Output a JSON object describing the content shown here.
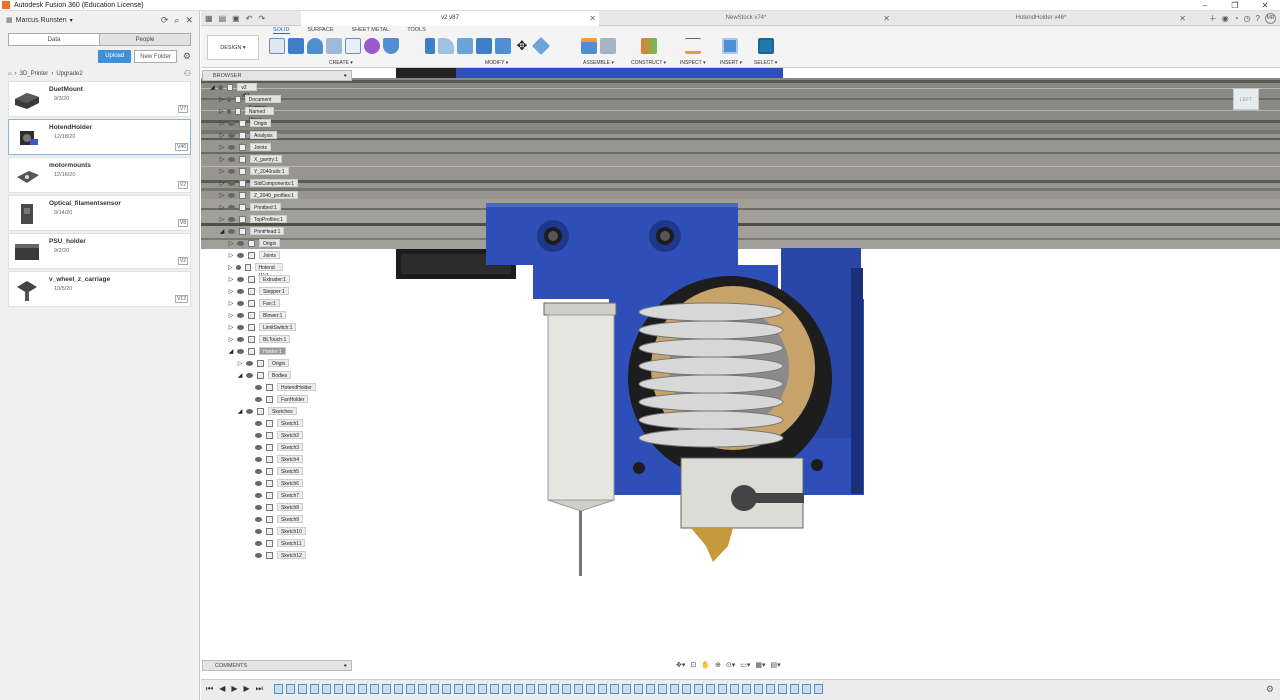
{
  "app": {
    "title": "Autodesk Fusion 360 (Education License)"
  },
  "datapanel": {
    "user": "Marcus Runsten",
    "tabs": [
      "Data",
      "People"
    ],
    "upload": "Upload",
    "new_folder": "New Folder",
    "breadcrumb": [
      "3D_Printer",
      "Upgrade2"
    ],
    "files": [
      {
        "name": "DuetMount",
        "date": "9/3/20",
        "version": "V7"
      },
      {
        "name": "HotendHolder",
        "date": "12/18/20",
        "version": "V46"
      },
      {
        "name": "motormounts",
        "date": "12/16/20",
        "version": "V2"
      },
      {
        "name": "Optical_filamentsensor",
        "date": "9/14/20",
        "version": "V8"
      },
      {
        "name": "PSU_holder",
        "date": "9/2/20",
        "version": "V2"
      },
      {
        "name": "v_wheel_z_carriage",
        "date": "10/5/20",
        "version": "V12"
      }
    ]
  },
  "doctabs": [
    "v2 v87",
    "NewStock v74*",
    "HotendHolder v46*"
  ],
  "user_initials": "MR",
  "toolbar": {
    "design": "DESIGN",
    "workspace_tabs": [
      "SOLID",
      "SURFACE",
      "SHEET METAL",
      "TOOLS"
    ],
    "groups": [
      "CREATE",
      "MODIFY",
      "ASSEMBLE",
      "CONSTRUCT",
      "INSPECT",
      "INSERT",
      "SELECT"
    ]
  },
  "browser": {
    "title": "BROWSER",
    "rows": [
      {
        "label": "v2 v87",
        "depth": 0,
        "arrow": "◢",
        "highlight": false
      },
      {
        "label": "Document Settings",
        "depth": 1,
        "arrow": "▷",
        "highlight": false
      },
      {
        "label": "Named Views",
        "depth": 1,
        "arrow": "▷",
        "highlight": false
      },
      {
        "label": "Origin",
        "depth": 1,
        "arrow": "▷",
        "highlight": false
      },
      {
        "label": "Analysis",
        "depth": 1,
        "arrow": "▷",
        "highlight": false
      },
      {
        "label": "Joints",
        "depth": 1,
        "arrow": "▷",
        "highlight": false
      },
      {
        "label": "X_gantry:1",
        "depth": 1,
        "arrow": "▷",
        "highlight": false
      },
      {
        "label": "Y_2040rails:1",
        "depth": 1,
        "arrow": "▷",
        "highlight": false
      },
      {
        "label": "StdComponents:1",
        "depth": 1,
        "arrow": "▷",
        "highlight": false
      },
      {
        "label": "Z_2040_profiles:1",
        "depth": 1,
        "arrow": "▷",
        "highlight": false
      },
      {
        "label": "Printbed:1",
        "depth": 1,
        "arrow": "▷",
        "highlight": false
      },
      {
        "label": "TopProfiles:1",
        "depth": 1,
        "arrow": "▷",
        "highlight": false
      },
      {
        "label": "PrintHead:1",
        "depth": 1,
        "arrow": "◢",
        "highlight": false
      },
      {
        "label": "Origin",
        "depth": 2,
        "arrow": "▷",
        "highlight": false
      },
      {
        "label": "Joints",
        "depth": 2,
        "arrow": "▷",
        "highlight": false
      },
      {
        "label": "Hotend (1):1",
        "depth": 2,
        "arrow": "▷",
        "highlight": false
      },
      {
        "label": "Extruder:1",
        "depth": 2,
        "arrow": "▷",
        "highlight": false
      },
      {
        "label": "Stepper:1",
        "depth": 2,
        "arrow": "▷",
        "highlight": false
      },
      {
        "label": "Fan:1",
        "depth": 2,
        "arrow": "▷",
        "highlight": false
      },
      {
        "label": "Blower:1",
        "depth": 2,
        "arrow": "▷",
        "highlight": false
      },
      {
        "label": "LimitSwitch:1",
        "depth": 2,
        "arrow": "▷",
        "highlight": false
      },
      {
        "label": "BLTouch:1",
        "depth": 2,
        "arrow": "▷",
        "highlight": false
      },
      {
        "label": "Holder:1",
        "depth": 2,
        "arrow": "◢",
        "highlight": true
      },
      {
        "label": "Origin",
        "depth": 3,
        "arrow": "▷",
        "highlight": false
      },
      {
        "label": "Bodies",
        "depth": 3,
        "arrow": "◢",
        "highlight": false
      },
      {
        "label": "HotendHolder",
        "depth": 4,
        "arrow": "",
        "highlight": false
      },
      {
        "label": "FanHolder",
        "depth": 4,
        "arrow": "",
        "highlight": false
      },
      {
        "label": "Sketches",
        "depth": 3,
        "arrow": "◢",
        "highlight": false
      },
      {
        "label": "Sketch1",
        "depth": 4,
        "arrow": "",
        "highlight": false
      },
      {
        "label": "Sketch2",
        "depth": 4,
        "arrow": "",
        "highlight": false
      },
      {
        "label": "Sketch3",
        "depth": 4,
        "arrow": "",
        "highlight": false
      },
      {
        "label": "Sketch4",
        "depth": 4,
        "arrow": "",
        "highlight": false
      },
      {
        "label": "Sketch5",
        "depth": 4,
        "arrow": "",
        "highlight": false
      },
      {
        "label": "Sketch6",
        "depth": 4,
        "arrow": "",
        "highlight": false
      },
      {
        "label": "Sketch7",
        "depth": 4,
        "arrow": "",
        "highlight": false
      },
      {
        "label": "Sketch8",
        "depth": 4,
        "arrow": "",
        "highlight": false
      },
      {
        "label": "Sketch9",
        "depth": 4,
        "arrow": "",
        "highlight": false
      },
      {
        "label": "Sketch10",
        "depth": 4,
        "arrow": "",
        "highlight": false
      },
      {
        "label": "Sketch11",
        "depth": 4,
        "arrow": "",
        "highlight": false
      },
      {
        "label": "Sketch12",
        "depth": 4,
        "arrow": "",
        "highlight": false
      }
    ]
  },
  "comments": "COMMENTS",
  "viewcube": "LEFT",
  "colors": {
    "accent": "#1b6ac9",
    "part_blue": "#2f4fb8",
    "upload": "#3f8fd7"
  }
}
